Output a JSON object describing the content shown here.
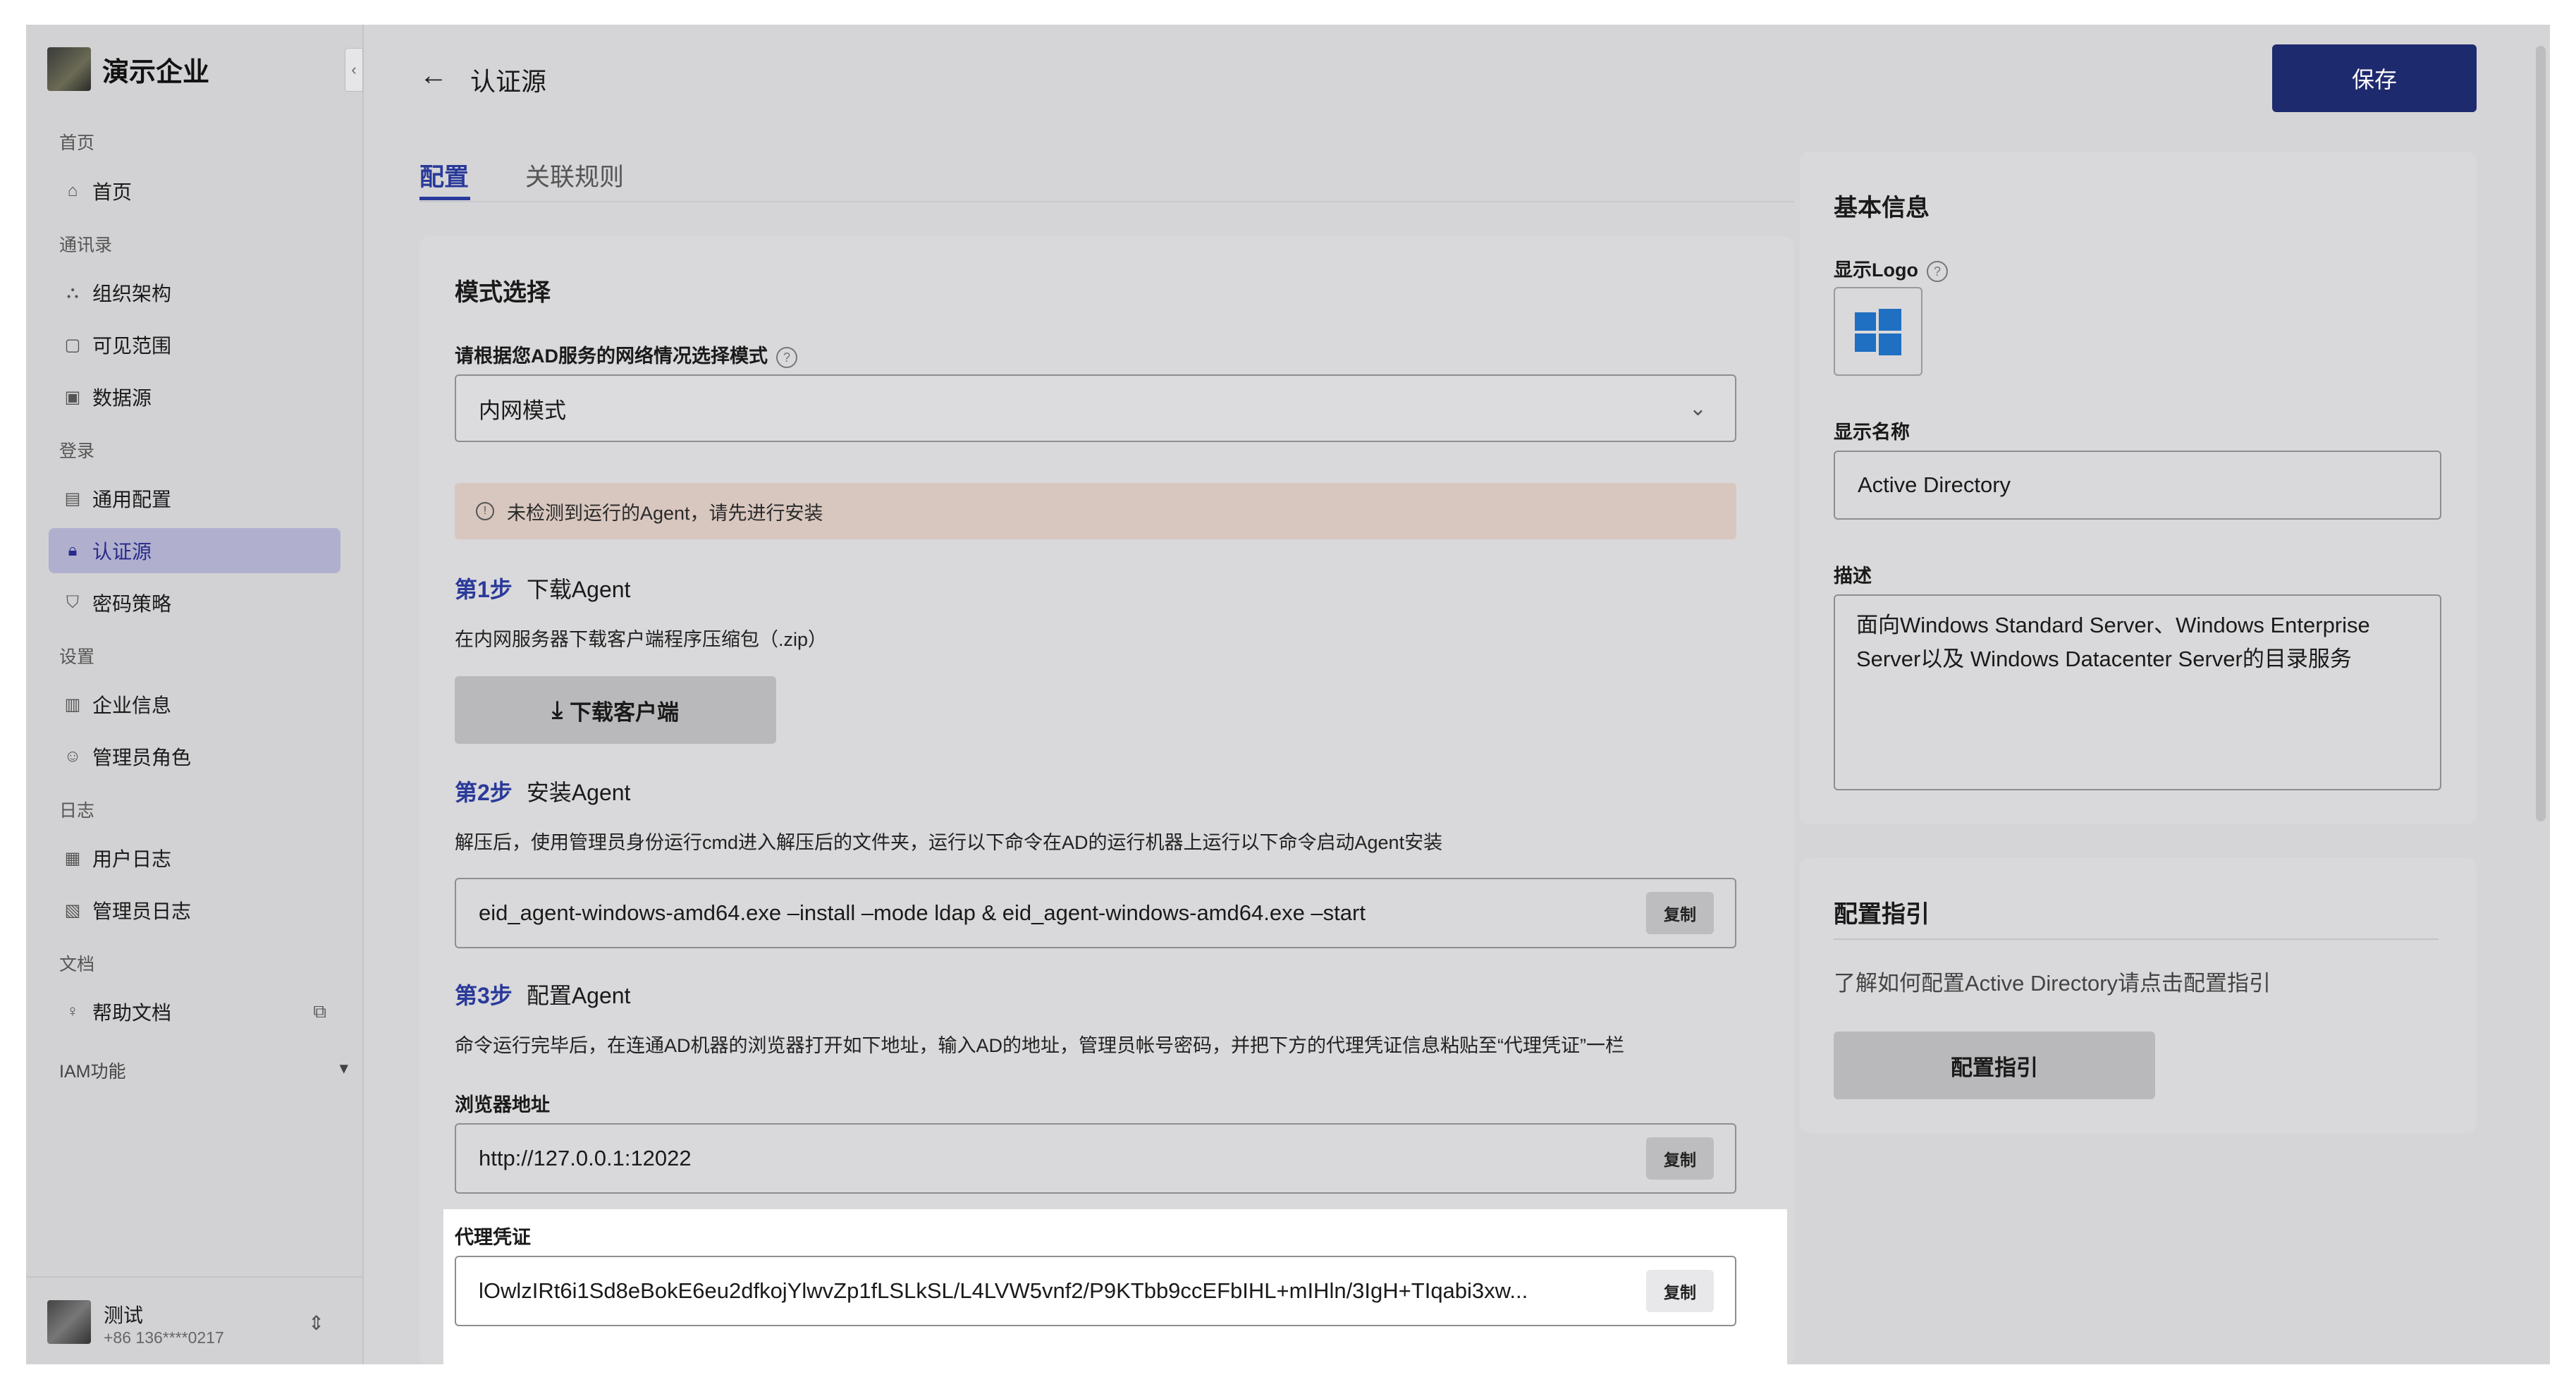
{
  "brand": {
    "name": "演示企业"
  },
  "sidebar": {
    "collapse": "‹",
    "groups": {
      "home": "首页",
      "contacts": "通讯录",
      "login": "登录",
      "settings": "设置",
      "logs": "日志",
      "docs": "文档"
    },
    "items": [
      {
        "label": "首页",
        "icon": "home-icon"
      },
      {
        "label": "组织架构",
        "icon": "org-structure-icon"
      },
      {
        "label": "可见范围",
        "icon": "visibility-icon"
      },
      {
        "label": "数据源",
        "icon": "data-source-icon"
      },
      {
        "label": "通用配置",
        "icon": "config-icon"
      },
      {
        "label": "认证源",
        "icon": "lock-icon"
      },
      {
        "label": "密码策略",
        "icon": "shield-icon"
      },
      {
        "label": "企业信息",
        "icon": "building-icon"
      },
      {
        "label": "管理员角色",
        "icon": "admin-role-icon"
      },
      {
        "label": "用户日志",
        "icon": "user-log-icon"
      },
      {
        "label": "管理员日志",
        "icon": "admin-log-icon"
      },
      {
        "label": "帮助文档",
        "icon": "help-bulb-icon"
      }
    ],
    "iam": {
      "label": "IAM功能",
      "caret": "▾"
    }
  },
  "user": {
    "name": "测试",
    "phone": "+86 136****0217"
  },
  "header": {
    "title": "认证源",
    "save_label": "保存"
  },
  "tabs": [
    {
      "label": "配置"
    },
    {
      "label": "关联规则"
    }
  ],
  "mode": {
    "title": "模式选择",
    "label": "请根据您AD服务的网络情况选择模式",
    "selected": "内网模式",
    "alert": "未检测到运行的Agent，请先进行安装"
  },
  "steps": [
    {
      "num": "第1步",
      "title": "下载Agent",
      "desc": "在内网服务器下载客户端程序压缩包（.zip）",
      "button": "下载客户端"
    },
    {
      "num": "第2步",
      "title": "安装Agent",
      "desc": "解压后，使用管理员身份运行cmd进入解压后的文件夹，运行以下命令在AD的运行机器上运行以下命令启动Agent安装",
      "command": "eid_agent-windows-amd64.exe –install –mode ldap & eid_agent-windows-amd64.exe –start"
    },
    {
      "num": "第3步",
      "title": "配置Agent",
      "desc": "命令运行完毕后，在连通AD机器的浏览器打开如下地址，输入AD的地址，管理员帐号密码，并把下方的代理凭证信息粘贴至“代理凭证”一栏"
    }
  ],
  "browser": {
    "label": "浏览器地址",
    "value": "http://127.0.0.1:12022"
  },
  "proxy": {
    "label": "代理凭证",
    "value": "lOwlzIRt6i1Sd8eBokE6eu2dfkojYlwvZp1fLSLkSL/L4LVW5vnf2/P9KTbb9ccEFbIHL+mIHln/3IgH+TIqabi3xw..."
  },
  "copy_label": "复制",
  "basic_info": {
    "title": "基本信息",
    "logo_label": "显示Logo",
    "name_label": "显示名称",
    "name_value": "Active Directory",
    "desc_label": "描述",
    "desc_value": "面向Windows Standard Server、Windows Enterprise Server以及 Windows Datacenter Server的目录服务"
  },
  "guide": {
    "title": "配置指引",
    "text": "了解如何配置Active Directory请点击配置指引",
    "button": "配置指引"
  },
  "colors": {
    "accent": "#2a3a9a",
    "primary_button": "#1e2a6e",
    "alert_bg": "#d8c7bf",
    "windows_logo": "#1f6fc2"
  }
}
